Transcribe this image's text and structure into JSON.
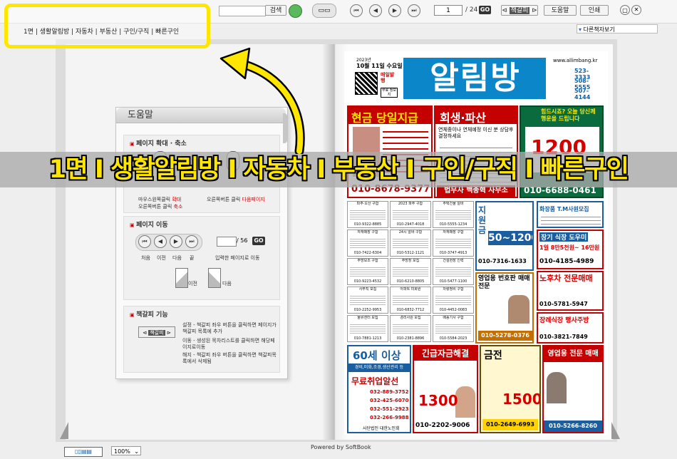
{
  "toolbar": {
    "search_label": "검색",
    "page_current": "1",
    "page_total": "/ 24",
    "go_label": "GO",
    "bookmark_label": "책갈피",
    "help_label": "도움말",
    "print_label": "인쇄",
    "other_books_label": "다른책자보기"
  },
  "nav": {
    "items": [
      "1면",
      "생활알림방",
      "자동차",
      "부동산",
      "구인/구직",
      "빠른구인"
    ]
  },
  "banner": {
    "text": "1면 I 생활알림방 I 자동차 I 부동산 I 구인/구직 I 빠른구인"
  },
  "help": {
    "title": "도움말",
    "zoom_title": "페이지 확대 · 축소",
    "zoom_left_1": "마우스왼쪽클릭",
    "zoom_left_1_red": "확대",
    "zoom_left_2": "오른쪽버튼 클릭",
    "zoom_left_2_red": "축소",
    "zoom_right": "오른쪽버튼 클릭",
    "zoom_right_red": "다음페이지",
    "move_title": "페이지 이동",
    "move_page_total": "/ 56",
    "move_go": "GO",
    "move_labels": [
      "처음",
      "이전",
      "다음",
      "끝"
    ],
    "move_input_hint": "입력한 페이지로 이동",
    "prev_label": "이전",
    "next_label": "다음",
    "bookmark_title": "책갈피 기능",
    "bookmark_btn": "책갈피",
    "bm_set": "설정 - 책갈피 좌우 버튼을 클릭하면 페이지가 책갈피 목록에 추가",
    "bm_move": "이동 - 생성된 목차리스트를 클릭하면 해당페이지로이동",
    "bm_delete": "해지 - 책갈피 좌우 버튼을 클릭하면 책갈피목록에서 삭제됨"
  },
  "newspaper": {
    "date_year": "2023년",
    "date": "10월 11일 수요일",
    "issue": "매일발행",
    "free": "무료 정보지",
    "title": "알림방",
    "url": "www.allimbang.kr",
    "phone_1": "523-3333",
    "phone_2": "508-5555",
    "fax": "507-4144",
    "ad1_title": "현금 당일지급",
    "ad1_phone": "010-8678-9377",
    "ad2_title": "회생·파산",
    "ad2_sub": "연체중이나 연체예정 이신 분 상담후 결정하세요",
    "ad2_firm": "법무사 백종혁 사무소",
    "ad3_title": "힘드시죠? 오늘 당신께 행운을 드립니다",
    "ad3_amount": "1200",
    "ad3_phone": "010-6688-0461",
    "mid_ad_title": "지원금",
    "mid_ad_amount": "50~1200",
    "mid_ad_phone": "010-7316-1633",
    "car_title": "화장품 T.M사원모집",
    "kitchen_title": "장기 식장 도우미",
    "kitchen_sub": "1일 8만5천원~ 16만원",
    "kitchen_phone": "010-4185-4989",
    "old_car_title": "노후차 전문매매",
    "old_car_phone": "010-5781-5947",
    "wedding_title": "장례식장 행사주방",
    "wedding_phone": "010-3821-7849",
    "middle_title": "영업용 번호판 매매전문",
    "middle_phone": "010-5278-0376",
    "senior_title": "60세 이상",
    "senior_sub": "경비,미화,조경,생산관리 등",
    "senior_tag": "무료취업알선",
    "senior_phones": [
      "032-889-3752",
      "032-425-6070",
      "032-551-2923",
      "032-266-9988"
    ],
    "senior_footer": "사단법인 대한노인회",
    "loan_title": "긴급자금해결",
    "loan_amount": "1300",
    "loan_phone": "010-2202-9006",
    "gold_title": "금전",
    "gold_amount": "1500",
    "gold_phone": "010-2649-6993",
    "bottom_right_title": "영업용 전문 매매",
    "bottom_right_phone": "010-5266-8260",
    "grid_heads": [
      "파주·오산 구함",
      "2023 파주 구함",
      "주택건물 알바",
      "자재매장 구함",
      "24시 알바 구함",
      "자재매장 구함",
      "주방보조 구함",
      "주방장 모집",
      "건설현장 인력",
      "사무직 모집",
      "아파트 미화원",
      "차량정비 구함",
      "물류센터 모집",
      "경리사원 모집",
      "배송기사 구함"
    ],
    "grid_phones": [
      "010-9322-8885",
      "010-2947-4018",
      "010-5555-1234",
      "010-7422-6304",
      "010-5312-1121",
      "010-3747-4913",
      "010-9223-4532",
      "010-6210-8805",
      "010-5477-1100",
      "010-2252-9953",
      "010-6832-7712",
      "010-4452-0083",
      "010-7881-1213",
      "010-2381-8896",
      "010-5584-2023"
    ]
  },
  "footer": {
    "powered": "Powered by SoftBook",
    "zoom": "100%"
  },
  "colors": {
    "highlight": "#ffe600",
    "accent_red": "#d40000"
  }
}
